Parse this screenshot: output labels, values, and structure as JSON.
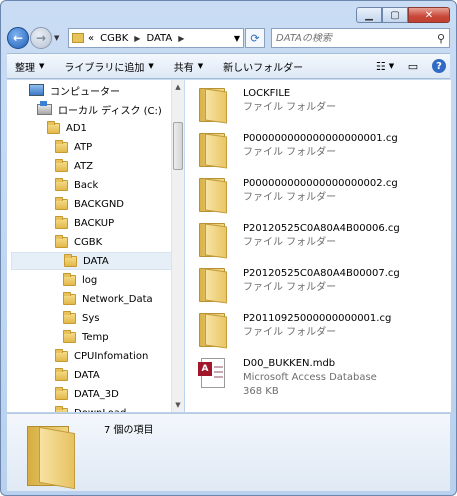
{
  "address": {
    "overflow": "«",
    "crumbs": [
      "CGBK",
      "DATA"
    ]
  },
  "search": {
    "placeholder": "DATAの検索"
  },
  "toolbar": {
    "organize": "整理",
    "add_to_library": "ライブラリに追加",
    "share": "共有",
    "new_folder": "新しいフォルダー"
  },
  "nav_tree": [
    {
      "label": "コンピューター",
      "icon": "computer-icon",
      "indent": 0
    },
    {
      "label": "ローカル ディスク (C:)",
      "icon": "disk-icon",
      "indent": 1
    },
    {
      "label": "AD1",
      "icon": "folder-icon",
      "indent": 2
    },
    {
      "label": "ATP",
      "icon": "folder-icon",
      "indent": 3
    },
    {
      "label": "ATZ",
      "icon": "folder-icon",
      "indent": 3
    },
    {
      "label": "Back",
      "icon": "folder-icon",
      "indent": 3
    },
    {
      "label": "BACKGND",
      "icon": "folder-icon",
      "indent": 3
    },
    {
      "label": "BACKUP",
      "icon": "folder-icon",
      "indent": 3
    },
    {
      "label": "CGBK",
      "icon": "folder-icon",
      "indent": 3
    },
    {
      "label": "DATA",
      "icon": "folder-icon",
      "indent": 4,
      "selected": true
    },
    {
      "label": "log",
      "icon": "folder-icon",
      "indent": 4
    },
    {
      "label": "Network_Data",
      "icon": "folder-icon",
      "indent": 4
    },
    {
      "label": "Sys",
      "icon": "folder-icon",
      "indent": 4
    },
    {
      "label": "Temp",
      "icon": "folder-icon",
      "indent": 4
    },
    {
      "label": "CPUInfomation",
      "icon": "folder-icon",
      "indent": 3
    },
    {
      "label": "DATA",
      "icon": "folder-icon",
      "indent": 3
    },
    {
      "label": "DATA_3D",
      "icon": "folder-icon",
      "indent": 3
    },
    {
      "label": "DownLoad",
      "icon": "folder-icon",
      "indent": 3
    }
  ],
  "files": [
    {
      "name": "LOCKFILE",
      "type": "ファイル フォルダー",
      "icon": "folder-icon"
    },
    {
      "name": "P000000000000000000001.cg",
      "type": "ファイル フォルダー",
      "icon": "folder-icon"
    },
    {
      "name": "P000000000000000000002.cg",
      "type": "ファイル フォルダー",
      "icon": "folder-icon"
    },
    {
      "name": "P20120525C0A80A4B00006.cg",
      "type": "ファイル フォルダー",
      "icon": "folder-icon"
    },
    {
      "name": "P20120525C0A80A4B00007.cg",
      "type": "ファイル フォルダー",
      "icon": "folder-icon"
    },
    {
      "name": "P20110925000000000001.cg",
      "type": "ファイル フォルダー",
      "icon": "folder-icon"
    },
    {
      "name": "D00_BUKKEN.mdb",
      "type": "Microsoft Access Database",
      "size": "368 KB",
      "icon": "access-db-icon"
    }
  ],
  "details": {
    "count": "7 個の項目"
  }
}
